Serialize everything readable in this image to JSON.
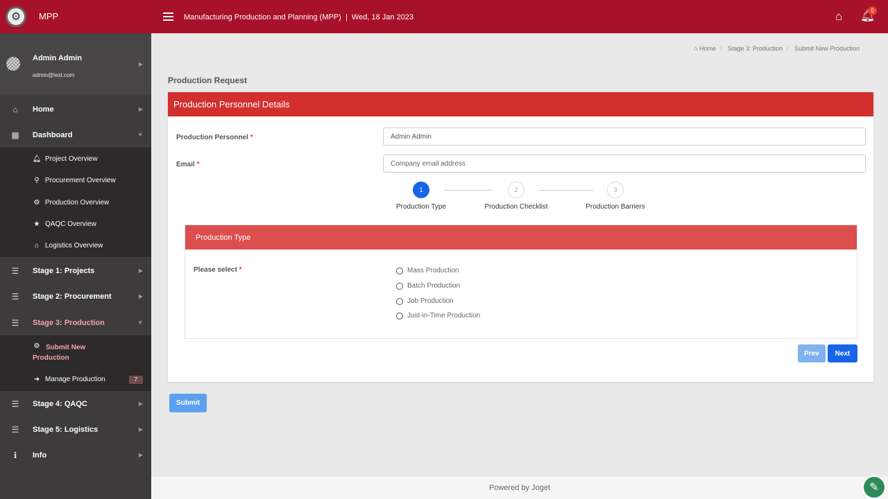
{
  "topbar": {
    "brand": "MPP",
    "title": "Manufacturing Production and Planning (MPP)  |  Wed, 18 Jan 2023",
    "notification_count": "0"
  },
  "user": {
    "name": "Admin Admin",
    "email": "admin@test.com"
  },
  "sidebar": {
    "home": "Home",
    "dashboard": "Dashboard",
    "dashboard_items": [
      "Project Overview",
      "Procurement Overview",
      "Production Overview",
      "QAQC Overview",
      "Logistics Overview"
    ],
    "stage1": "Stage 1: Projects",
    "stage2": "Stage 2: Procurement",
    "stage3": "Stage 3: Production",
    "stage3_items": [
      "Submit New Production",
      "Manage Production"
    ],
    "manage_count": "7",
    "stage4": "Stage 4: QAQC",
    "stage5": "Stage 5: Logistics",
    "info": "Info"
  },
  "breadcrumb": [
    "Home",
    "Stage 3: Production",
    "Submit New Production"
  ],
  "page_title": "Production Request",
  "form": {
    "header": "Production Personnel Details",
    "personnel_label": "Production Personnel",
    "personnel_value": "Admin Admin",
    "email_label": "Email",
    "email_placeholder": "Company email address",
    "required_mark": "*"
  },
  "wizard": {
    "steps": [
      {
        "num": "1",
        "label": "Production Type"
      },
      {
        "num": "2",
        "label": "Production Checklist"
      },
      {
        "num": "3",
        "label": "Production Barriers"
      }
    ],
    "active_step": 1
  },
  "production_type": {
    "header": "Production Type",
    "question": "Please select",
    "options": [
      "Mass Production",
      "Batch Production",
      "Job Production",
      "Just-in-Time Production"
    ]
  },
  "buttons": {
    "prev": "Prev",
    "next": "Next",
    "submit": "Submit"
  },
  "footer": "Powered by Joget",
  "colors": {
    "topbar": "#a8112a",
    "card_header": "#d32f2f",
    "primary": "#1565e6"
  }
}
